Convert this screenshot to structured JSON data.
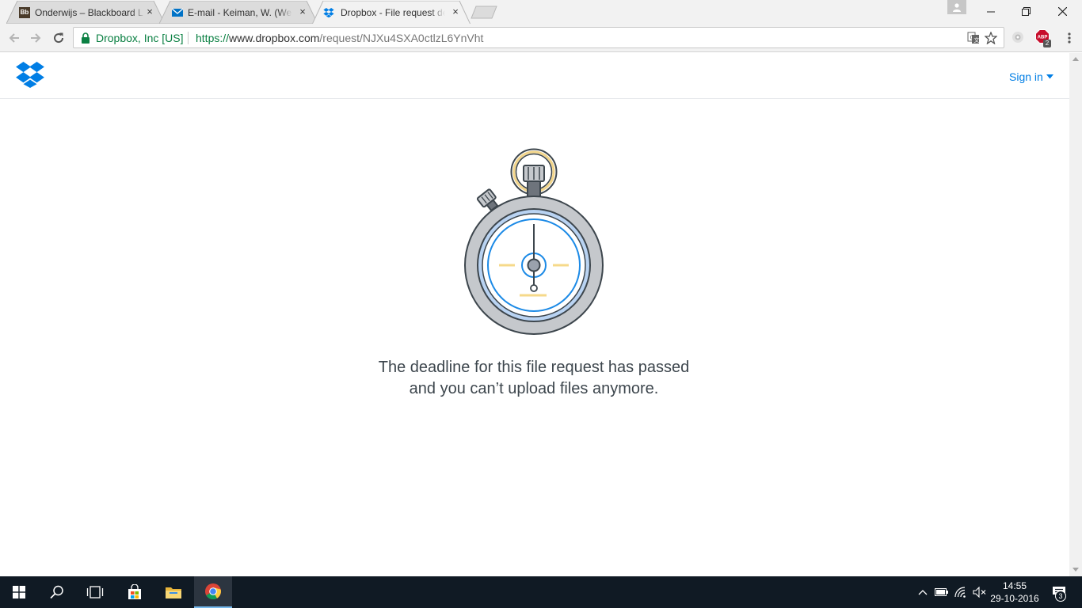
{
  "browser": {
    "tabs": [
      {
        "title": "Onderwijs – Blackboard L",
        "favicon": "blackboard-icon",
        "favicon_text": "Bb",
        "active": false
      },
      {
        "title": "E-mail - Keiman, W. (Wes",
        "favicon": "mail-icon",
        "active": false
      },
      {
        "title": "Dropbox - File request de",
        "favicon": "dropbox-icon",
        "active": true
      }
    ],
    "close_glyph": "×",
    "site_identity": "Dropbox, Inc [US]",
    "url": {
      "scheme": "https://",
      "host": "www.dropbox.com",
      "path": "/request/NJXu4SXA0ctlzL6YnVht"
    },
    "extensions": [
      {
        "icon": "extension-icon"
      },
      {
        "icon": "adblock-plus-icon",
        "label": "ABP",
        "badge": "2"
      }
    ]
  },
  "page": {
    "header": {
      "logo": "dropbox-logo",
      "sign_in_label": "Sign in"
    },
    "illustration": "stopwatch-illustration",
    "message": "The deadline for this file request has passed and you can’t upload files anymore."
  },
  "taskbar": {
    "clock_time": "14:55",
    "clock_date": "29-10-2016",
    "notification_count": "3"
  },
  "colors": {
    "dropbox_blue": "#007ee5",
    "secure_green": "#0b8043",
    "taskbar": "#101a24"
  }
}
